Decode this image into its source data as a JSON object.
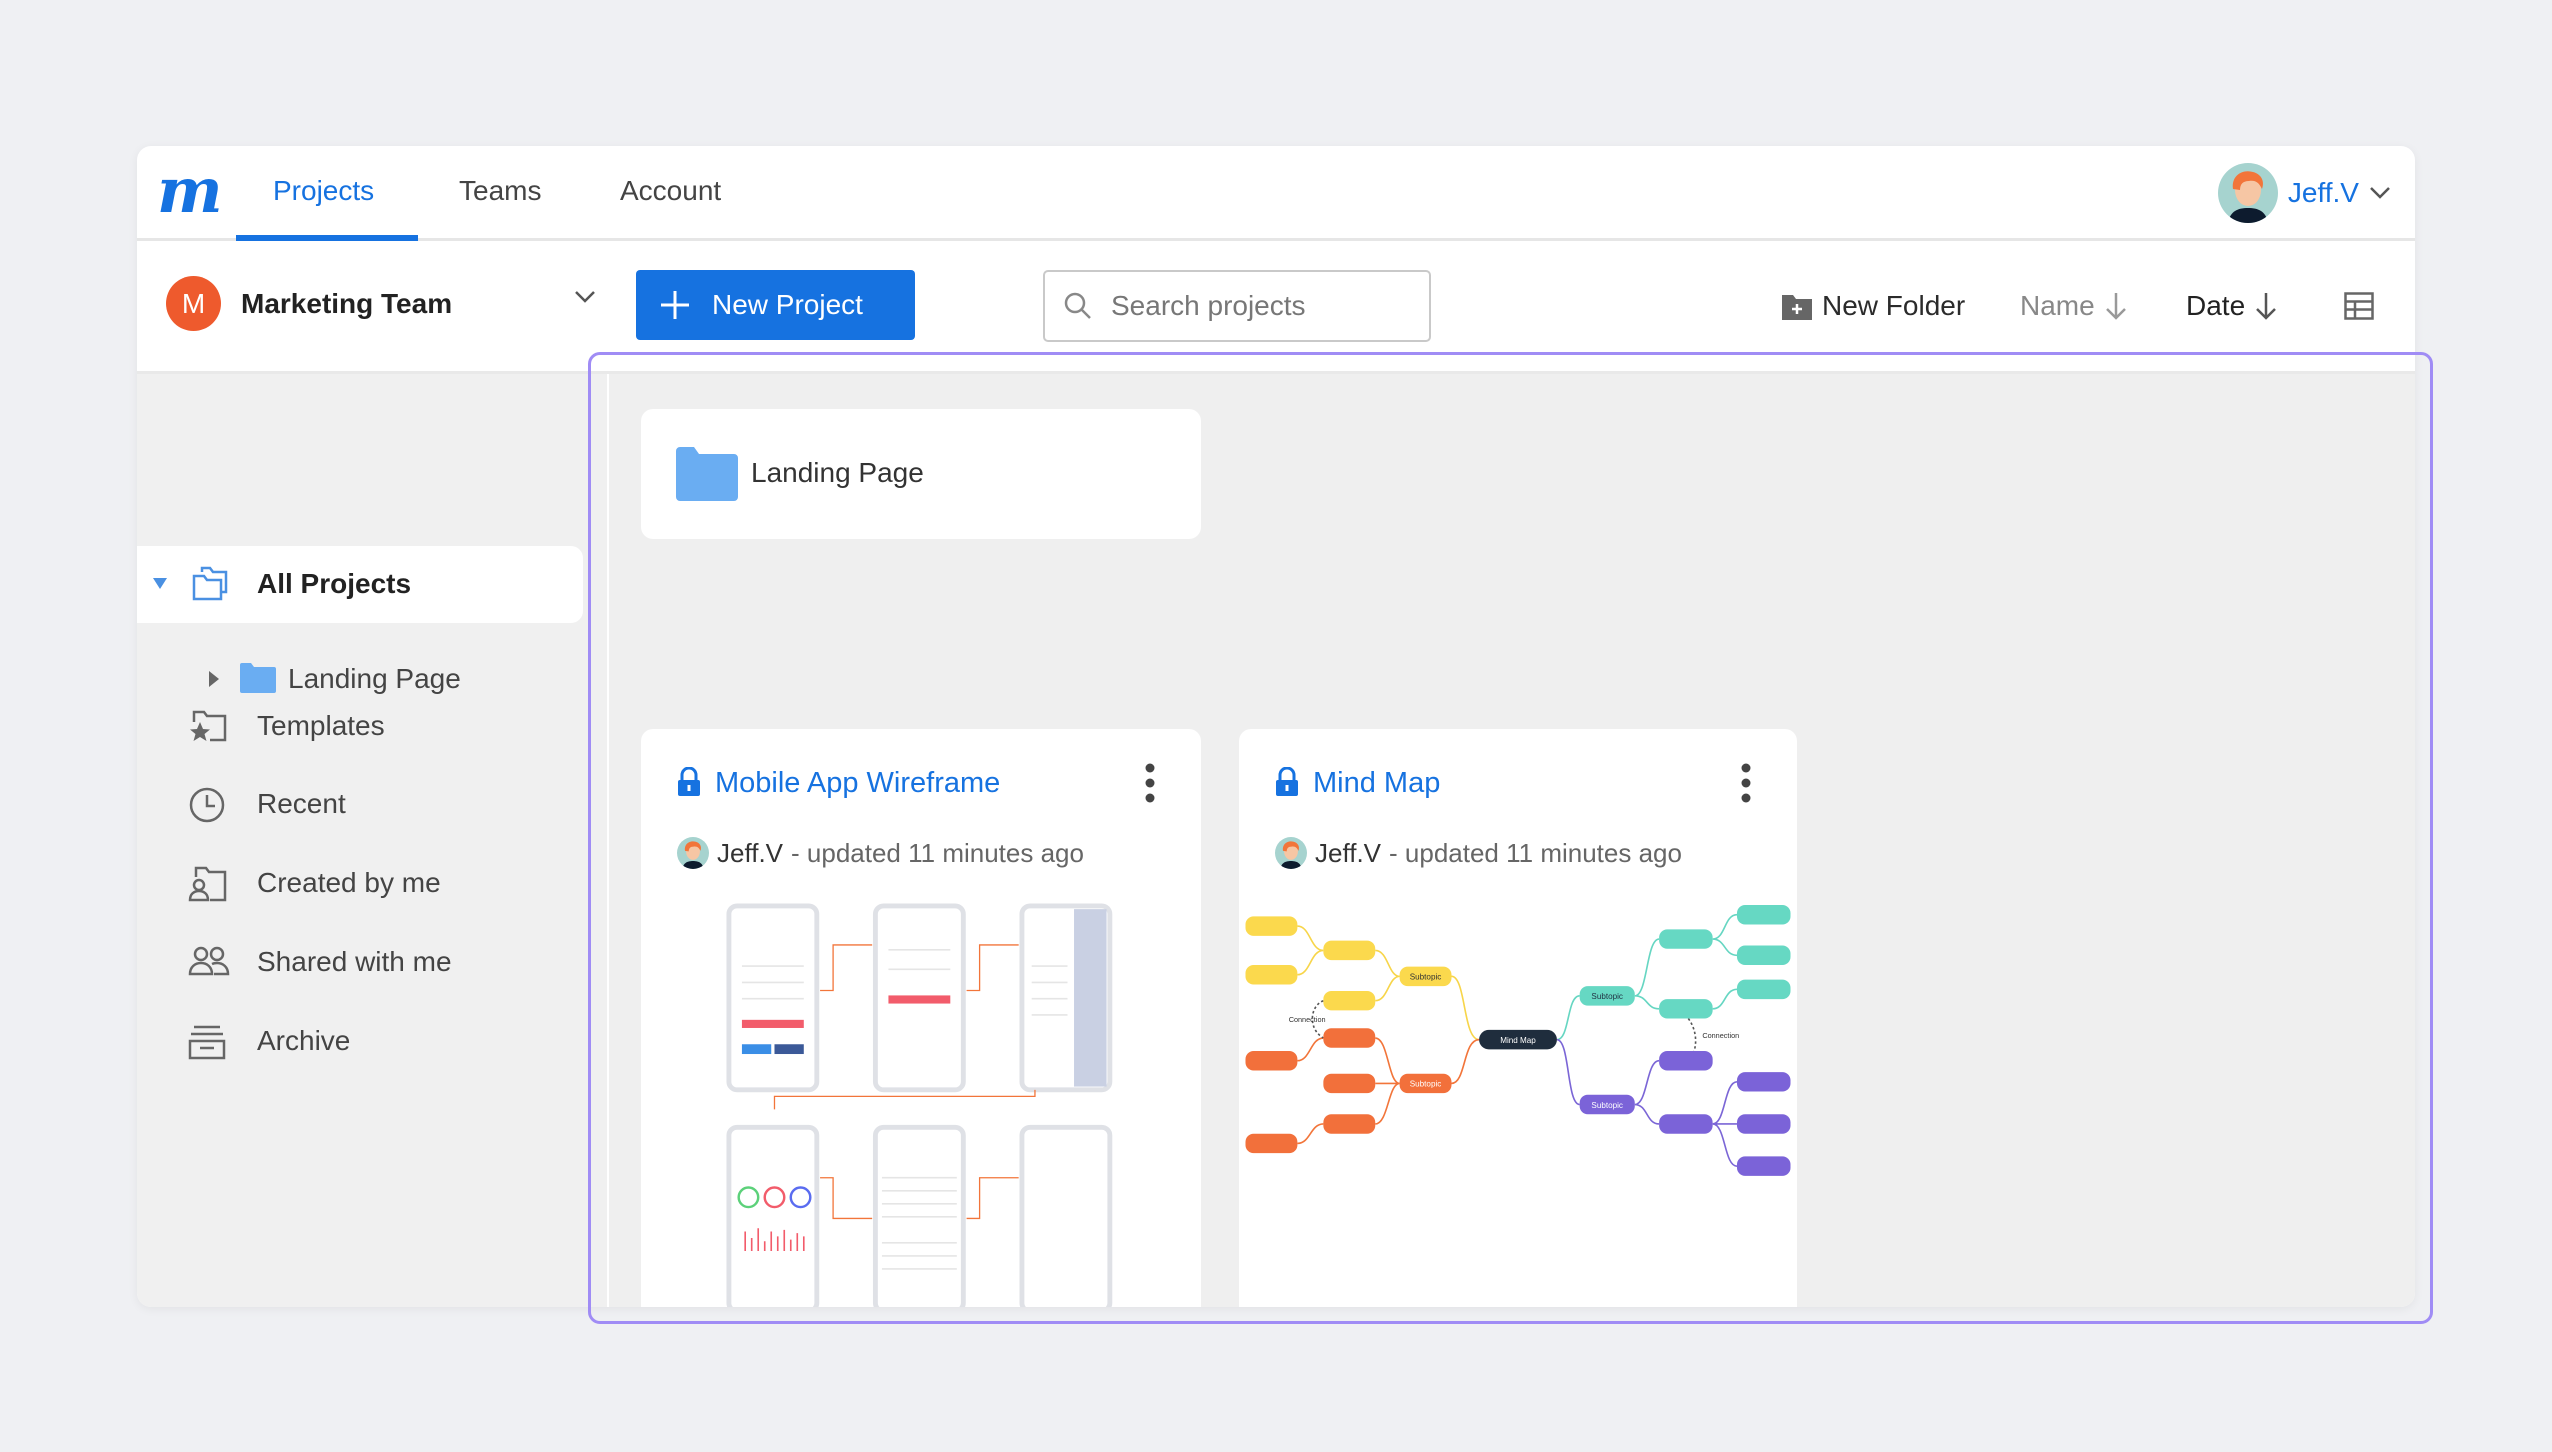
{
  "app": {
    "logo": "m",
    "brand_color": "#1672e0"
  },
  "nav": {
    "tabs": [
      {
        "label": "Projects",
        "active": true
      },
      {
        "label": "Teams"
      },
      {
        "label": "Account"
      }
    ]
  },
  "user": {
    "name": "Jeff.V",
    "icon": "chevron-down-icon"
  },
  "team": {
    "initial": "M",
    "name": "Marketing Team",
    "color": "#ee5a2d"
  },
  "toolbar": {
    "new_project": "New Project",
    "search_placeholder": "Search projects",
    "new_folder": "New Folder",
    "sort_name": "Name",
    "sort_date": "Date",
    "view_icon": "table-view-icon"
  },
  "sidebar": {
    "items": [
      {
        "label": "All Projects",
        "icon": "folders-icon",
        "selected": true
      },
      {
        "label": "Landing Page",
        "icon": "folder-icon"
      },
      {
        "label": "Templates",
        "icon": "templates-icon"
      },
      {
        "label": "Recent",
        "icon": "clock-icon"
      },
      {
        "label": "Created by me",
        "icon": "user-doc-icon"
      },
      {
        "label": "Shared with me",
        "icon": "users-icon"
      },
      {
        "label": "Archive",
        "icon": "archive-icon"
      }
    ]
  },
  "folders": [
    {
      "name": "Landing Page"
    }
  ],
  "projects": [
    {
      "title": "Mobile App Wireframe",
      "owner": "Jeff.V",
      "updated": "- updated 11 minutes ago"
    },
    {
      "title": "Mind Map",
      "owner": "Jeff.V",
      "updated": "- updated 11 minutes ago",
      "thumb": {
        "center": "Mind Map",
        "subtopic": "Subtopic",
        "connection": "Connection"
      }
    }
  ]
}
